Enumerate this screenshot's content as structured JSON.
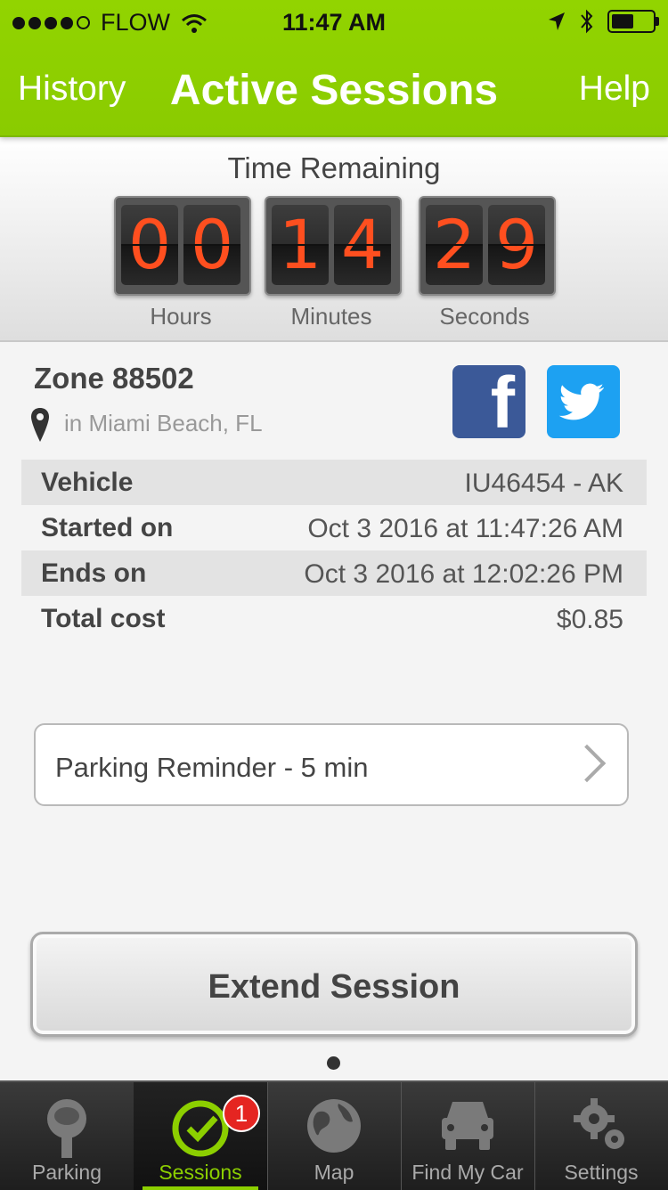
{
  "status_bar": {
    "carrier": "FLOW",
    "time": "11:47 AM"
  },
  "header": {
    "left": "History",
    "title": "Active Sessions",
    "right": "Help"
  },
  "timer": {
    "title": "Time Remaining",
    "hours": [
      "0",
      "0"
    ],
    "minutes": [
      "1",
      "4"
    ],
    "seconds": [
      "2",
      "9"
    ],
    "hours_label": "Hours",
    "minutes_label": "Minutes",
    "seconds_label": "Seconds"
  },
  "zone": {
    "title": "Zone 88502",
    "location": "in Miami Beach, FL"
  },
  "details": [
    {
      "label": "Vehicle",
      "value": "IU46454 - AK"
    },
    {
      "label": "Started on",
      "value": "Oct 3 2016 at 11:47:26 AM"
    },
    {
      "label": "Ends on",
      "value": "Oct 3 2016 at 12:02:26 PM"
    },
    {
      "label": "Total cost",
      "value": "$0.85"
    }
  ],
  "reminder": {
    "label": "Parking Reminder - 5 min"
  },
  "extend_button": "Extend Session",
  "tabs": [
    {
      "label": "Parking",
      "icon": "parking-meter-icon"
    },
    {
      "label": "Sessions",
      "icon": "clock-check-icon",
      "badge": "1",
      "active": true
    },
    {
      "label": "Map",
      "icon": "globe-icon"
    },
    {
      "label": "Find My Car",
      "icon": "car-icon"
    },
    {
      "label": "Settings",
      "icon": "gears-icon"
    }
  ],
  "colors": {
    "brand_green": "#8ccf00",
    "digit_orange": "#ff4f1f",
    "facebook": "#3b5998",
    "twitter": "#1da1f2",
    "badge_red": "#e52521"
  }
}
